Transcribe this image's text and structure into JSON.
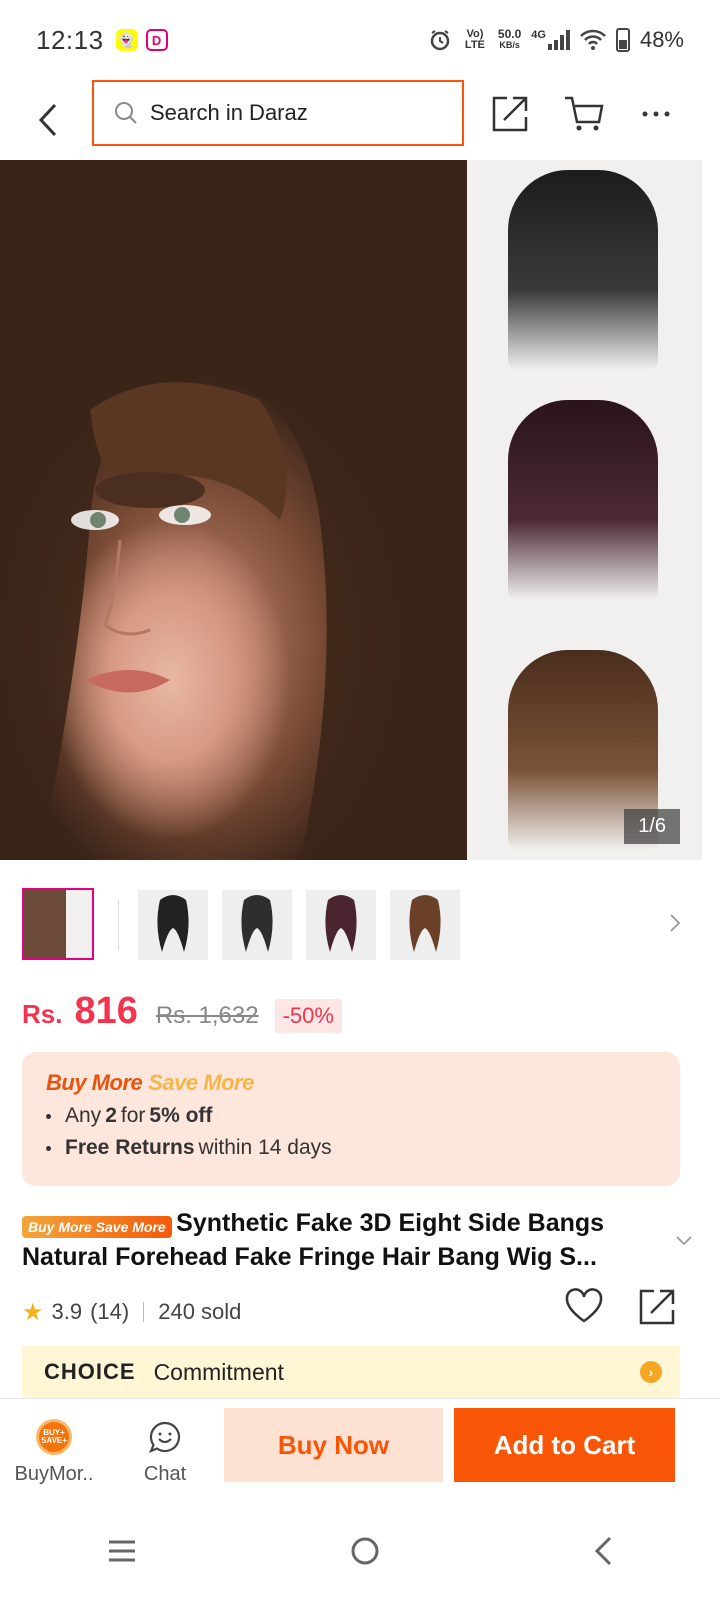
{
  "status_bar": {
    "time": "12:13",
    "volte": "Vo) LTE",
    "speed": "50.0",
    "speed_unit": "KB/s",
    "network": "4G",
    "battery": "48%"
  },
  "nav": {
    "search_placeholder": "Search in Daraz"
  },
  "gallery": {
    "counter": "1/6",
    "thumbnails": [
      "main",
      "black",
      "black-2",
      "dark-brown",
      "brown"
    ]
  },
  "price": {
    "currency": "Rs.",
    "current": "816",
    "original": "Rs. 1,632",
    "discount": "-50%"
  },
  "promo": {
    "title_buy": "Buy More",
    "title_save": "Save More",
    "line1_pre": "Any",
    "line1_qty": "2",
    "line1_mid": "for",
    "line1_off": "5% off",
    "line2_bold": "Free Returns",
    "line2_rest": "within 14 days"
  },
  "product": {
    "badge": "Buy More Save More",
    "title": "Synthetic Fake 3D Eight Side Bangs Natural Forehead Fake Fringe Hair Bang Wig S..."
  },
  "rating": {
    "score": "3.9",
    "count": "(14)",
    "sold": "240 sold"
  },
  "choice": {
    "logo": "CHOICE",
    "text": "Commitment"
  },
  "action_bar": {
    "buymore_label": "BuyMor..",
    "buymore_icon_text": "BUY+ SAVE+",
    "chat_label": "Chat",
    "buy_now": "Buy Now",
    "add_to_cart": "Add to Cart"
  },
  "colors": {
    "accent": "#f85606",
    "price": "#f4334e"
  }
}
